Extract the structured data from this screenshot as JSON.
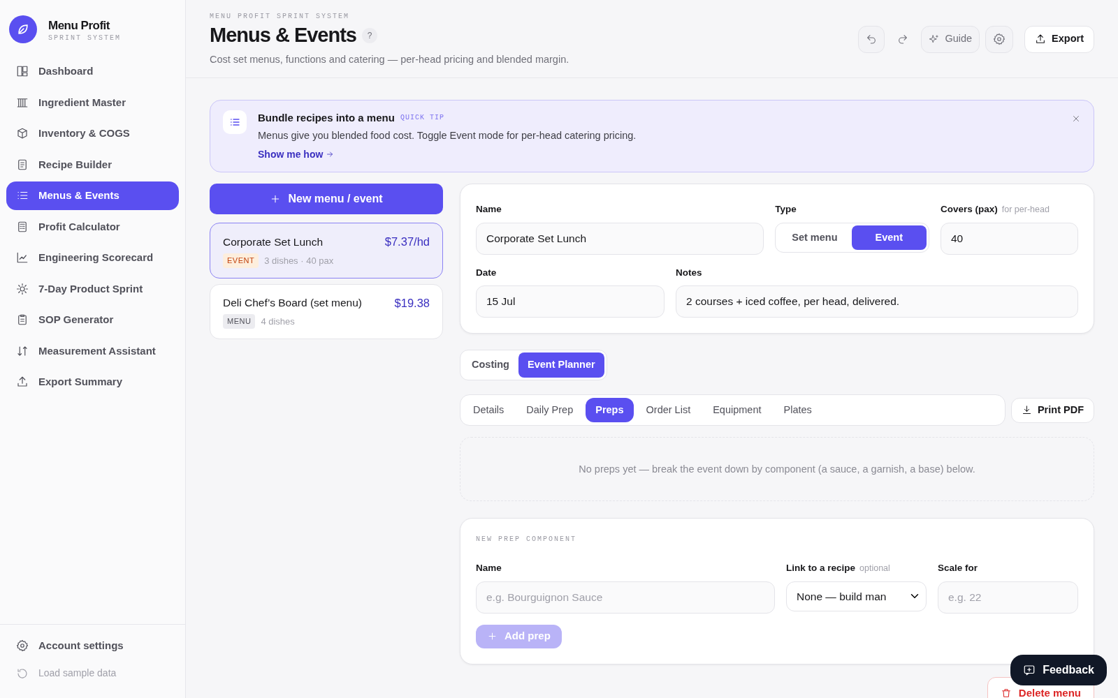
{
  "brand": {
    "name": "Menu Profit",
    "tagline": "SPRINT SYSTEM"
  },
  "sidebar": {
    "items": [
      {
        "label": "Dashboard",
        "selected": false
      },
      {
        "label": "Ingredient Master",
        "selected": false
      },
      {
        "label": "Inventory & COGS",
        "selected": false
      },
      {
        "label": "Recipe Builder",
        "selected": false
      },
      {
        "label": "Menus & Events",
        "selected": true
      },
      {
        "label": "Profit Calculator",
        "selected": false
      },
      {
        "label": "Engineering Scorecard",
        "selected": false
      },
      {
        "label": "7-Day Product Sprint",
        "selected": false
      },
      {
        "label": "SOP Generator",
        "selected": false
      },
      {
        "label": "Measurement Assistant",
        "selected": false
      },
      {
        "label": "Export Summary",
        "selected": false
      }
    ],
    "footer": [
      {
        "label": "Account settings",
        "kind": "settings"
      },
      {
        "label": "Load sample data",
        "kind": "reload"
      }
    ]
  },
  "header": {
    "eyebrow": "MENU PROFIT SPRINT SYSTEM",
    "title": "Menus & Events",
    "help": "?",
    "subtitle": "Cost set menus, functions and catering — per-head pricing and blended margin.",
    "guide": "Guide",
    "export": "Export"
  },
  "tip": {
    "title": "Bundle recipes into a menu",
    "tag": "QUICK TIP",
    "text": "Menus give you blended food cost. Toggle Event mode for per-head catering pricing.",
    "link": "Show me how"
  },
  "new_button": "New menu / event",
  "menus": [
    {
      "name": "Corporate Set Lunch",
      "price": "$7.37/hd",
      "tag": "EVENT",
      "kind": "event",
      "meta": "3 dishes · 40 pax",
      "selected": true
    },
    {
      "name": "Deli Chef’s Board (set menu)",
      "price": "$19.38",
      "tag": "MENU",
      "kind": "menu",
      "meta": "4 dishes",
      "selected": false
    }
  ],
  "form": {
    "name": {
      "label": "Name",
      "value": "Corporate Set Lunch"
    },
    "type": {
      "label": "Type",
      "options": [
        {
          "label": "Set menu",
          "selected": false
        },
        {
          "label": "Event",
          "selected": true
        }
      ]
    },
    "covers": {
      "label": "Covers (pax)",
      "hint": "for per-head",
      "value": "40"
    },
    "date": {
      "label": "Date",
      "value": "15 Jul"
    },
    "notes": {
      "label": "Notes",
      "value": "2 courses + iced coffee, per head, delivered."
    }
  },
  "mode_tabs": [
    {
      "label": "Costing",
      "selected": false
    },
    {
      "label": "Event Planner",
      "selected": true
    }
  ],
  "sub_tabs": [
    {
      "label": "Details",
      "selected": false
    },
    {
      "label": "Daily Prep",
      "selected": false
    },
    {
      "label": "Preps",
      "selected": true
    },
    {
      "label": "Order List",
      "selected": false
    },
    {
      "label": "Equipment",
      "selected": false
    },
    {
      "label": "Plates",
      "selected": false
    }
  ],
  "print_button": "Print PDF",
  "empty_message": "No preps yet — break the event down by component (a sauce, a garnish, a base) below.",
  "new_prep": {
    "heading": "NEW PREP COMPONENT",
    "name": {
      "label": "Name",
      "placeholder": "e.g. Bourguignon Sauce"
    },
    "link": {
      "label": "Link to a recipe",
      "hint": "optional",
      "value": "None — build man"
    },
    "scale": {
      "label": "Scale for",
      "placeholder": "e.g. 22"
    },
    "add": {
      "label": "Add prep",
      "disabled": true
    }
  },
  "delete_button": "Delete menu",
  "feedback_button": "Feedback"
}
